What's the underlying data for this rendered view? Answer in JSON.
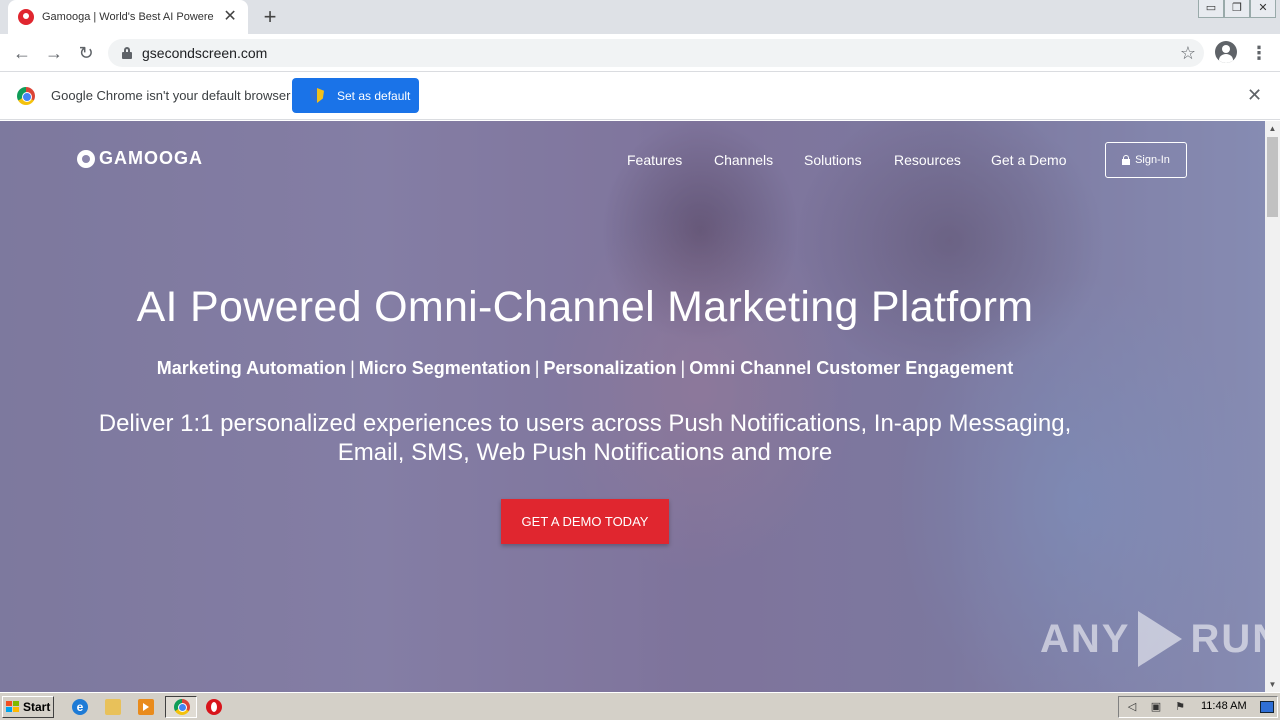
{
  "browser": {
    "tab": {
      "title": "Gamooga | World's Best AI Powered",
      "close_glyph": "✕",
      "favicon": "gamooga-favicon-icon"
    },
    "new_tab_glyph": "+",
    "window_controls": [
      "▭",
      "❐",
      "✕"
    ],
    "nav": {
      "back_glyph": "←",
      "forward_glyph": "→",
      "reload_glyph": "↻"
    },
    "url": "gsecondscreen.com",
    "bookmark_glyph": "☆",
    "menu_glyph": "⋮",
    "infobar": {
      "message": "Google Chrome isn't your default browser",
      "button_label": "Set as default",
      "close_glyph": "✕"
    }
  },
  "site": {
    "logo_text": "GAMOOGA",
    "nav_items": [
      "Features",
      "Channels",
      "Solutions",
      "Resources",
      "Get a Demo"
    ],
    "signin_label": "Sign-In",
    "headline": "AI Powered Omni-Channel Marketing Platform",
    "subheadline_items": [
      "Marketing Automation",
      "Micro Segmentation",
      "Personalization",
      "Omni Channel Customer Engagement"
    ],
    "separator": "|",
    "description_line1": "Deliver 1:1 personalized experiences to users across Push Notifications, In-app Messaging,",
    "description_line2": "Email, SMS, Web Push Notifications and more",
    "cta_label": "GET A DEMO TODAY",
    "cta_color": "#e0262f"
  },
  "watermark": {
    "left": "ANY",
    "right": "RUN"
  },
  "taskbar": {
    "start_label": "Start",
    "clock": "11:48 AM",
    "ie_glyph": "e"
  },
  "colors": {
    "accent_blue": "#1a73e8",
    "overlay": "#584e8c"
  }
}
